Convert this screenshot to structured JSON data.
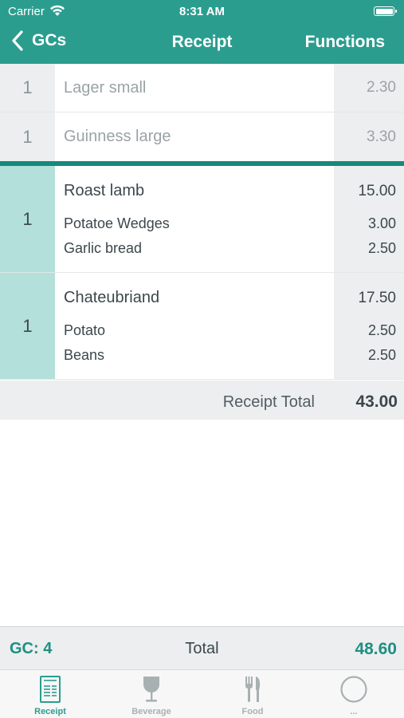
{
  "status_bar": {
    "carrier": "Carrier",
    "time": "8:31 AM"
  },
  "nav": {
    "back_label": "GCs",
    "title": "Receipt",
    "functions_label": "Functions"
  },
  "simple_items": [
    {
      "qty": "1",
      "name": "Lager small",
      "price": "2.30"
    },
    {
      "qty": "1",
      "name": "Guinness large",
      "price": "3.30"
    }
  ],
  "groups": [
    {
      "qty": "1",
      "name": "Roast lamb",
      "price": "15.00",
      "extras": [
        {
          "name": "Potatoe Wedges",
          "price": "3.00"
        },
        {
          "name": "Garlic bread",
          "price": "2.50"
        }
      ]
    },
    {
      "qty": "1",
      "name": "Chateubriand",
      "price": "17.50",
      "extras": [
        {
          "name": "Potato",
          "price": "2.50"
        },
        {
          "name": "Beans",
          "price": "2.50"
        }
      ]
    }
  ],
  "receipt_total": {
    "label": "Receipt Total",
    "value": "43.00"
  },
  "totals_bar": {
    "gc_label": "GC:  4",
    "total_label": "Total",
    "total_value": "48.60"
  },
  "tabs": [
    {
      "label": "Receipt",
      "icon": "receipt-icon",
      "active": true
    },
    {
      "label": "Beverage",
      "icon": "wine-glass-icon",
      "active": false
    },
    {
      "label": "Food",
      "icon": "fork-knife-icon",
      "active": false
    },
    {
      "label": "...",
      "icon": "more-circle-icon",
      "active": false
    }
  ],
  "colors": {
    "brand": "#2b9d8f",
    "accent_dark": "#15897c",
    "qty_highlight": "#b3e0da",
    "cell_gray": "#eceeef"
  }
}
